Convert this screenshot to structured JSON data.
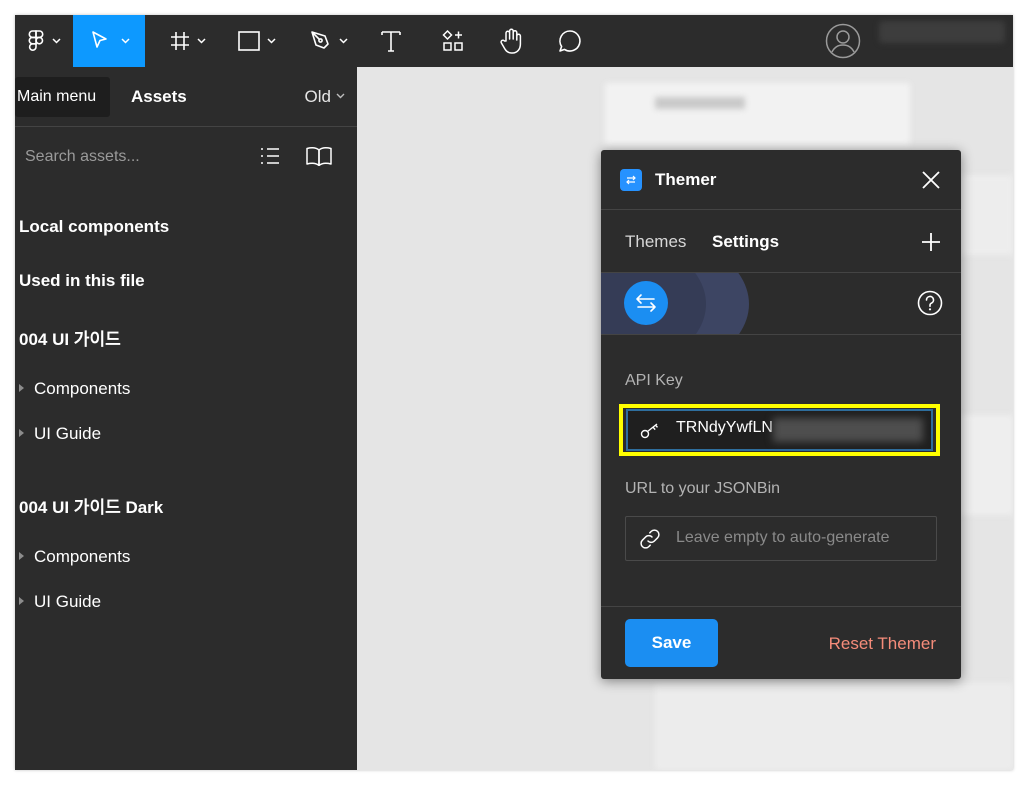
{
  "toolbar": {
    "tools": [
      "figma-menu",
      "move",
      "frame",
      "shape",
      "pen",
      "text",
      "resources",
      "hand",
      "comment"
    ],
    "active_tool": "move",
    "accent_color": "#0d99ff"
  },
  "left_panel": {
    "tabs": {
      "main_menu_tooltip": "Main menu",
      "assets": "Assets",
      "library_dropdown": "Old"
    },
    "search": {
      "placeholder": "Search assets..."
    },
    "tree": [
      {
        "label": "Local components",
        "kind": "section"
      },
      {
        "label": "Used in this file",
        "kind": "section"
      },
      {
        "label": "004 UI 가이드",
        "kind": "section"
      },
      {
        "label": "Components",
        "kind": "sub"
      },
      {
        "label": "UI Guide",
        "kind": "sub"
      },
      {
        "label": "004 UI 가이드 Dark",
        "kind": "section"
      },
      {
        "label": "Components",
        "kind": "sub"
      },
      {
        "label": "UI Guide",
        "kind": "sub"
      }
    ]
  },
  "dialog": {
    "title": "Themer",
    "tabs": {
      "themes": "Themes",
      "settings": "Settings"
    },
    "api_key": {
      "label": "API Key",
      "value_visible": "TRNdyYwfLN",
      "highlight_color": "#ffff00"
    },
    "jsonbin": {
      "label": "URL to your JSONBin",
      "placeholder": "Leave empty to auto-generate"
    },
    "buttons": {
      "save": "Save",
      "reset": "Reset Themer"
    },
    "colors": {
      "primary": "#1b8ef2",
      "danger_text": "#f58c7a"
    }
  }
}
